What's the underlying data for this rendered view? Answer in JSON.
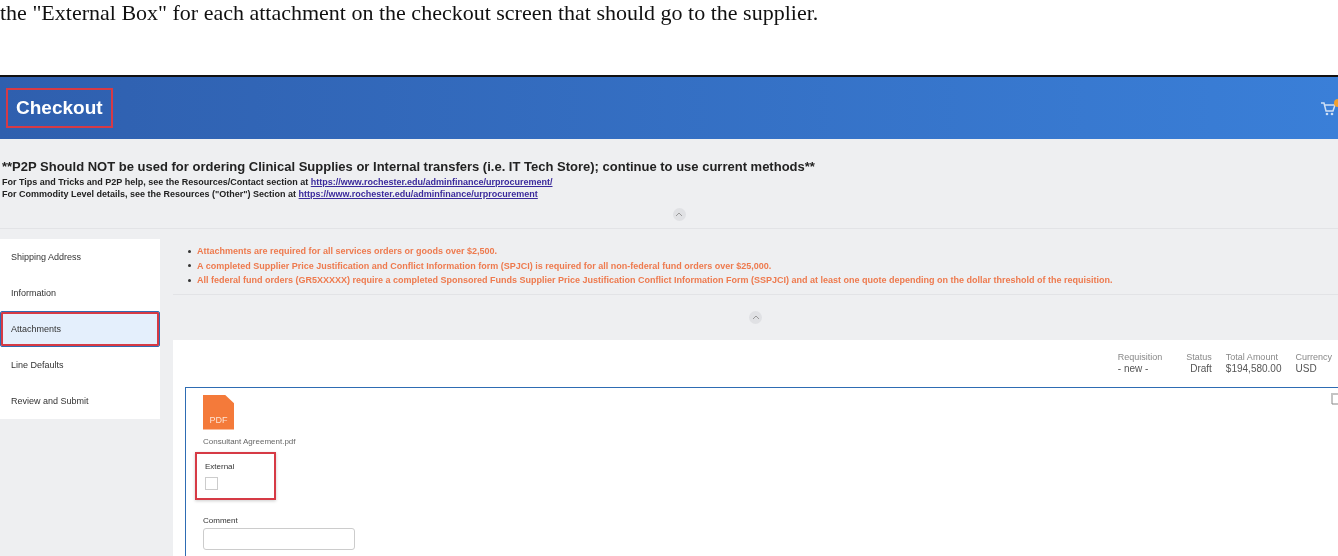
{
  "document_text": "the \"External Box\" for each attachment on the checkout screen that should go to the supplier.",
  "header": {
    "title": "Checkout",
    "highlighted": true
  },
  "notice": {
    "headline": "**P2P Should NOT be used for ordering Clinical Supplies or Internal transfers (i.e. IT Tech Store); continue to use current methods**",
    "lines": [
      {
        "text": "For Tips and Tricks and P2P help, see the Resources/Contact section at ",
        "link": "https://www.rochester.edu/adminfinance/urprocurement/"
      },
      {
        "text": "For Commodity Level details, see the Resources (\"Other\") Section at ",
        "link": "https://www.rochester.edu/adminfinance/urprocurement"
      }
    ]
  },
  "sidebar": {
    "items": [
      {
        "label": "Shipping Address",
        "selected": false,
        "highlighted": false
      },
      {
        "label": "Information",
        "selected": false,
        "highlighted": false
      },
      {
        "label": "Attachments",
        "selected": true,
        "highlighted": true
      },
      {
        "label": "Line Defaults",
        "selected": false,
        "highlighted": false
      },
      {
        "label": "Review and Submit",
        "selected": false,
        "highlighted": false
      }
    ]
  },
  "requirements": [
    "Attachments are required for all services orders or goods over $2,500.",
    "A completed Supplier Price Justification and Conflict Information form (SPJCI) is required for all non-federal fund orders over $25,000.",
    "All federal fund orders (GR5XXXXX) require a completed Sponsored Funds Supplier Price Justification Conflict Information Form (SSPJCI) and at least one quote depending on the dollar threshold of the requisition."
  ],
  "summary": [
    {
      "label": "Requisition",
      "value": "- new -"
    },
    {
      "label": "Status",
      "value": "Draft"
    },
    {
      "label": "Total Amount",
      "value": "$194,580.00"
    },
    {
      "label": "Currency",
      "value": "USD"
    }
  ],
  "attachment": {
    "file_type": "PDF",
    "file_name": "Consultant Agreement.pdf",
    "external_label": "External",
    "external_checked": false,
    "external_highlighted": true,
    "comment_label": "Comment"
  }
}
